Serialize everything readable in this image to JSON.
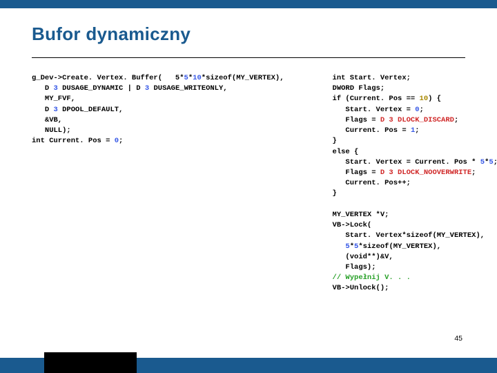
{
  "title": "Bufor dynamiczny",
  "page_number": "45",
  "code_left": [
    {
      "t": "g_Dev->Create. Vertex. Buffer("
    },
    {
      "t": "   5*"
    },
    {
      "t": "5",
      "c": "b"
    },
    {
      "t": "*"
    },
    {
      "t": "10",
      "c": "b"
    },
    {
      "t": "*sizeof(MY_VERTEX),\n"
    },
    {
      "t": "   D "
    },
    {
      "t": "3",
      "c": "b"
    },
    {
      "t": " DUSAGE_DYNAMIC | D "
    },
    {
      "t": "3",
      "c": "b"
    },
    {
      "t": " DUSAGE_WRITEONLY,\n"
    },
    {
      "t": "   MY_FVF,\n"
    },
    {
      "t": "   D "
    },
    {
      "t": "3",
      "c": "b"
    },
    {
      "t": " DPOOL_DEFAULT,\n"
    },
    {
      "t": "   &VB,\n"
    },
    {
      "t": "   NULL);\n"
    },
    {
      "t": "int Current. Pos = "
    },
    {
      "t": "0",
      "c": "b"
    },
    {
      "t": ";"
    }
  ],
  "code_right": [
    {
      "t": "int Start. Vertex;\n"
    },
    {
      "t": "DWORD Flags;\n"
    },
    {
      "t": "if (Current. Pos == "
    },
    {
      "t": "10",
      "c": "d"
    },
    {
      "t": ") {\n"
    },
    {
      "t": "   Start. Vertex = "
    },
    {
      "t": "0",
      "c": "b"
    },
    {
      "t": ";\n"
    },
    {
      "t": "   Flags = "
    },
    {
      "t": "D 3 DLOCK_DISCARD",
      "c": "r"
    },
    {
      "t": ";\n"
    },
    {
      "t": "   Current. Pos = "
    },
    {
      "t": "1",
      "c": "b"
    },
    {
      "t": ";\n"
    },
    {
      "t": "}\n"
    },
    {
      "t": "else {\n"
    },
    {
      "t": "   Start. Vertex = Current. Pos * "
    },
    {
      "t": "5",
      "c": "b"
    },
    {
      "t": "*"
    },
    {
      "t": "5",
      "c": "b"
    },
    {
      "t": ";\n"
    },
    {
      "t": "   Flags = "
    },
    {
      "t": "D 3 DLOCK_NOOVERWRITE",
      "c": "r"
    },
    {
      "t": ";\n"
    },
    {
      "t": "   Current. Pos++;\n"
    },
    {
      "t": "}\n"
    },
    {
      "t": "\n"
    },
    {
      "t": "MY_VERTEX *V;\n"
    },
    {
      "t": "VB->Lock(\n"
    },
    {
      "t": "   Start. Vertex*sizeof(MY_VERTEX),\n"
    },
    {
      "t": "   "
    },
    {
      "t": "5",
      "c": "b"
    },
    {
      "t": "*"
    },
    {
      "t": "5",
      "c": "b"
    },
    {
      "t": "*sizeof(MY_VERTEX),\n"
    },
    {
      "t": "   (void**)&V,\n"
    },
    {
      "t": "   Flags);\n"
    },
    {
      "t": "// Wypełnij V. . .",
      "c": "g"
    },
    {
      "t": "\n"
    },
    {
      "t": "VB->Unlock();"
    }
  ]
}
